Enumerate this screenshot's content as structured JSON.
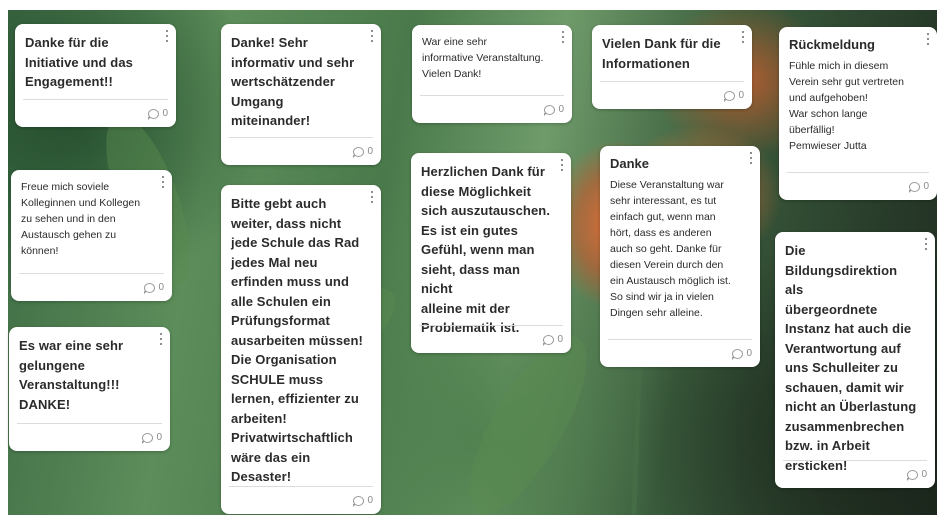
{
  "cards": [
    {
      "text": "Danke für die\nInitiative und das\nEngagement!!",
      "count": "0"
    },
    {
      "text": "Freue mich soviele\nKolleginnen und Kollegen\nzu sehen und in den\nAustausch gehen zu\nkönnen!",
      "count": "0"
    },
    {
      "text": "Es war eine sehr\ngelungene\nVeranstaltung!!!\nDANKE!",
      "count": "0"
    },
    {
      "text": "Danke! Sehr\ninformativ und sehr\nwertschätzender\nUmgang\nmiteinander!",
      "count": "0"
    },
    {
      "text": "Bitte gebt auch\nweiter, dass nicht\njede Schule das Rad\njedes Mal neu\nerfinden muss und\nalle Schulen ein\nPrüfungsformat\nausarbeiten müssen!\nDie Organisation\nSCHULE muss\nlernen, effizienter zu\narbeiten!\nPrivatwirtschaftlich\nwäre das ein\nDesaster!",
      "count": "0"
    },
    {
      "text": "War eine sehr\ninformative Veranstaltung.\nVielen Dank!",
      "count": "0"
    },
    {
      "text": "Herzlichen Dank für\ndiese Möglichkeit\nsich auszutauschen.\nEs ist ein gutes\nGefühl, wenn man\nsieht, dass man nicht\nalleine mit der\nProblematik ist.",
      "count": "0"
    },
    {
      "text": "Vielen Dank für die\nInformationen",
      "count": "0"
    },
    {
      "title": "Danke",
      "text": "Diese Veranstaltung war\nsehr interessant, es tut\neinfach gut, wenn man\nhört, dass es anderen\nauch so geht. Danke für\ndiesen Verein durch den\nein Austausch möglich ist.\nSo sind wir ja in vielen\nDingen sehr alleine.",
      "count": "0"
    },
    {
      "title": "Rückmeldung",
      "text": "Fühle mich in diesem\nVerein sehr gut vertreten\nund aufgehoben!\nWar schon lange\nüberfällig!\nPemwieser Jutta",
      "count": "0"
    },
    {
      "text": "Die\nBildungsdirektion als\nübergeordnete\nInstanz hat auch die\nVerantwortung auf\nuns Schulleiter zu\nschauen, damit wir\nnicht an Überlastung\nzusammenbrechen\nbzw. in Arbeit\nersticken!",
      "count": "0"
    }
  ]
}
